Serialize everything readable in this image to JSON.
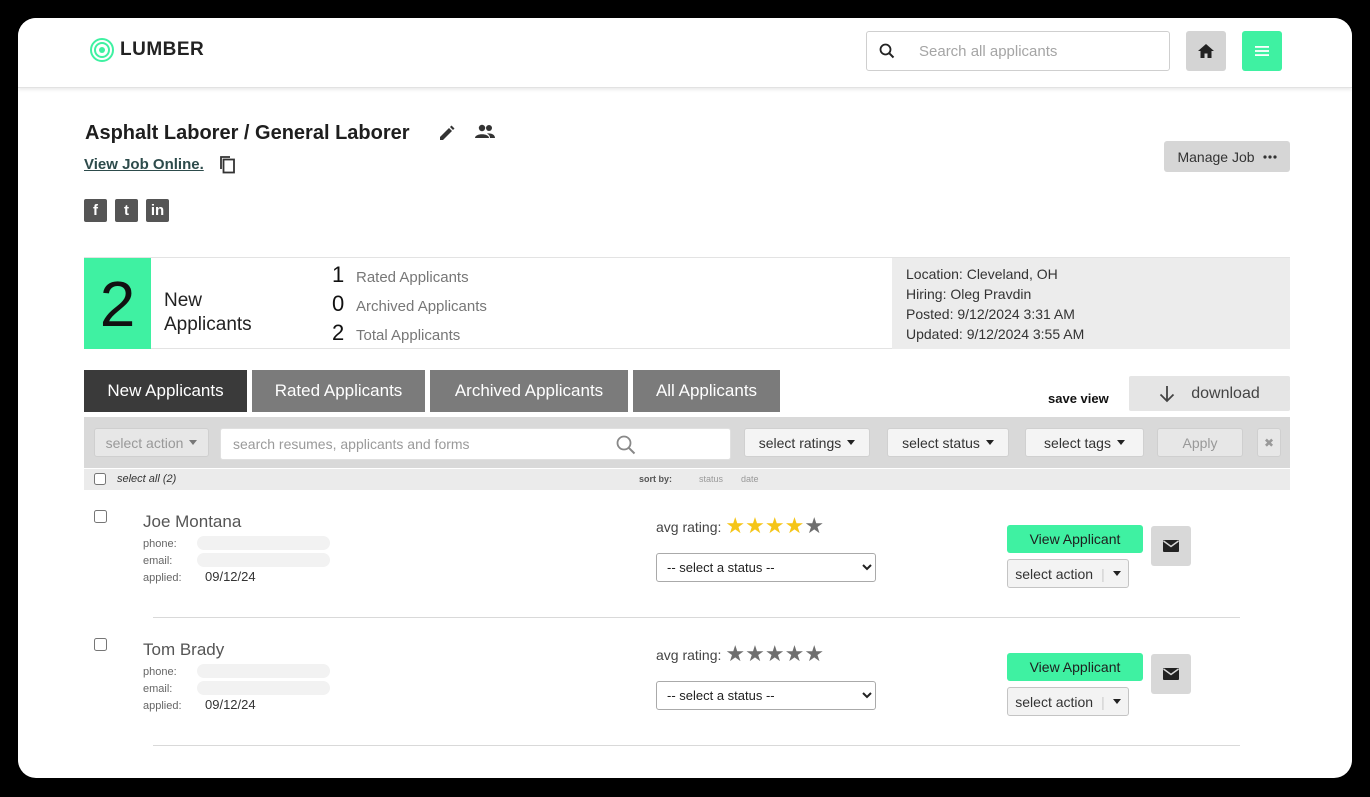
{
  "header": {
    "logo_text": "LUMBER",
    "search_placeholder": "Search all applicants",
    "home_icon": "home-icon",
    "menu_icon": "hamburger-icon",
    "accent_color": "#3ff1a2"
  },
  "job": {
    "title": "Asphalt Laborer / General Laborer",
    "view_online": "View Job Online.",
    "manage_label": "Manage Job",
    "social": [
      "f",
      "t",
      "in"
    ]
  },
  "stats": {
    "new_count": "2",
    "new_label_1": "New",
    "new_label_2": "Applicants",
    "rows": [
      {
        "count": "1",
        "label": "Rated Applicants"
      },
      {
        "count": "0",
        "label": "Archived Applicants"
      },
      {
        "count": "2",
        "label": "Total Applicants"
      }
    ],
    "meta": {
      "location": "Location: Cleveland, OH",
      "hiring": "Hiring: Oleg Pravdin",
      "posted": "Posted: 9/12/2024 3:31 AM",
      "updated": "Updated: 9/12/2024 3:55 AM"
    }
  },
  "tabs": [
    {
      "label": "New Applicants",
      "active": true
    },
    {
      "label": "Rated Applicants",
      "active": false
    },
    {
      "label": "Archived Applicants",
      "active": false
    },
    {
      "label": "All Applicants",
      "active": false
    }
  ],
  "save_view": "save view",
  "download_label": "download",
  "toolbar": {
    "select_action": "select action",
    "search_placeholder": "search resumes, applicants and forms",
    "select_ratings": "select ratings",
    "select_status": "select status",
    "select_tags": "select tags",
    "apply": "Apply",
    "close": "✖"
  },
  "list": {
    "select_all": "select all (2)",
    "sort_by": "sort by:",
    "sort_status": "status",
    "sort_date": "date"
  },
  "labels": {
    "phone": "phone:",
    "email": "email:",
    "applied": "applied:",
    "avg_rating": "avg rating:",
    "status_placeholder": "-- select a status --",
    "view_applicant": "View Applicant",
    "select_action": "select action"
  },
  "applicants": [
    {
      "name": "Joe Montana",
      "applied": "09/12/24",
      "rating": 4
    },
    {
      "name": "Tom Brady",
      "applied": "09/12/24",
      "rating": 0
    }
  ]
}
